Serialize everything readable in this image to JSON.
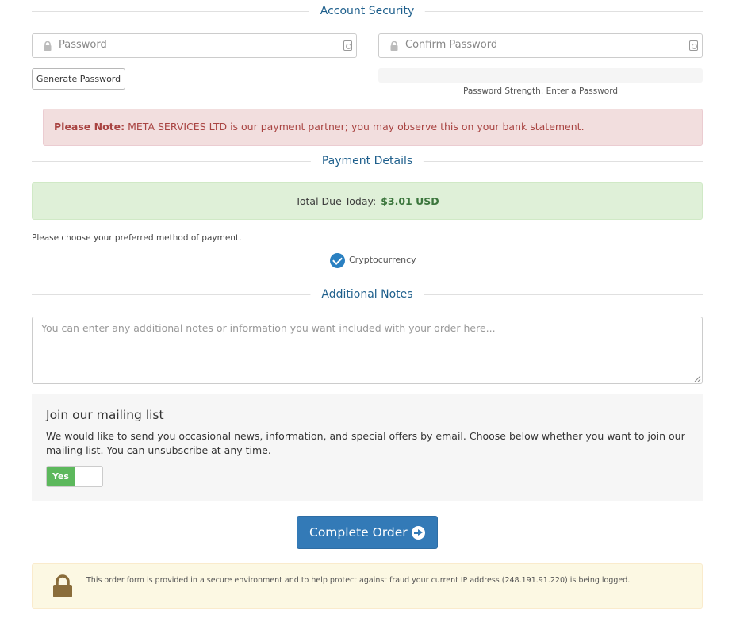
{
  "account_security": {
    "title": "Account Security",
    "password_placeholder": "Password",
    "confirm_placeholder": "Confirm Password",
    "generate_label": "Generate Password",
    "strength_text": "Password Strength: Enter a Password"
  },
  "notice": {
    "bold": "Please Note:",
    "text": "META SERVICES LTD is our payment partner; you may observe this on your bank statement."
  },
  "payment": {
    "title": "Payment Details",
    "total_label": "Total Due Today:",
    "total_amount": "$3.01 USD",
    "choose_text": "Please choose your preferred method of payment.",
    "method_label": "Cryptocurrency"
  },
  "notes": {
    "title": "Additional Notes",
    "placeholder": "You can enter any additional notes or information you want included with your order here..."
  },
  "mailing": {
    "title": "Join our mailing list",
    "text": "We would like to send you occasional news, information, and special offers by email. Choose below whether you want to join our mailing list. You can unsubscribe at any time.",
    "toggle_label": "Yes"
  },
  "complete_label": "Complete Order",
  "secure_text": "This order form is provided in a secure environment and to help protect against fraud your current IP address (248.191.91.220) is being logged.",
  "colors": {
    "accent": "#337ab7",
    "section_title": "#1e5f8c",
    "success": "#5cb85c",
    "danger_bg": "#f2dede",
    "warning_bg": "#fcf8e3"
  }
}
